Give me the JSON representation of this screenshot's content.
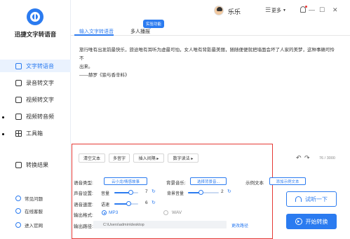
{
  "app": {
    "name": "迅捷文字转语音"
  },
  "sidebar": {
    "items": [
      {
        "label": "文字转语音"
      },
      {
        "label": "录音转文字"
      },
      {
        "label": "视频转文字"
      },
      {
        "label": "视频转音频"
      },
      {
        "label": "工具箱"
      },
      {
        "label": "转换结果"
      }
    ],
    "bottom": [
      {
        "label": "常见问题"
      },
      {
        "label": "在线客服"
      },
      {
        "label": "进入官网"
      }
    ]
  },
  "titlebar": {
    "username": "乐乐",
    "more_label": "更多",
    "minimize": "—",
    "maximize": "☐",
    "close": "✕"
  },
  "tabs": [
    {
      "label": "输入文字转语音"
    },
    {
      "label": "多人播报"
    }
  ],
  "badge": "实验功能",
  "editor": {
    "text_line1": "旅行唯有出发前最快乐，旅途唯有耳听为虚最可怕，女人唯有背影最美丽，随随便便就把墙面会坏了人家的美梦，这种事确可怜不",
    "text_line2": "出来。",
    "text_line3": "——赫罗《狼与香辛料》",
    "buttons": [
      {
        "label": "清空文本"
      },
      {
        "label": "多音字"
      },
      {
        "label": "插入间隔 ▸"
      },
      {
        "label": "数字读法 ▸"
      }
    ],
    "undo": "↶",
    "redo": "↷",
    "counter": "76 / 3000"
  },
  "settings": {
    "voice_type_label": "语音类型:",
    "voice_type_value": "云小龙/情感故事",
    "bg_music_label": "背景音乐:",
    "bg_music_value": "选择背景音...",
    "sample_text_label": "示例文本",
    "sample_text_value": "添加示例文本",
    "sound_label": "声音设置:",
    "volume_label": "音量",
    "volume_value": "7",
    "volume_level": 0.7,
    "bg_volume_label": "背景音量",
    "bg_volume_value": "2",
    "bg_volume_level": 0.2,
    "speed_label": "语音速度:",
    "speed_sub": "语速",
    "speed_value": "6",
    "speed_level": 0.6,
    "format_label": "输出格式:",
    "format_mp3": "MP3",
    "format_wav": "WAV",
    "path_label": "输出路径:",
    "path_value": "C:\\Users\\admin\\desktop",
    "change_path": "更改路径"
  },
  "actions": {
    "try_label": "试听一下",
    "start_label": "开始转换"
  },
  "colors": {
    "accent": "#2b7bf0",
    "highlight_box": "#e53935"
  }
}
